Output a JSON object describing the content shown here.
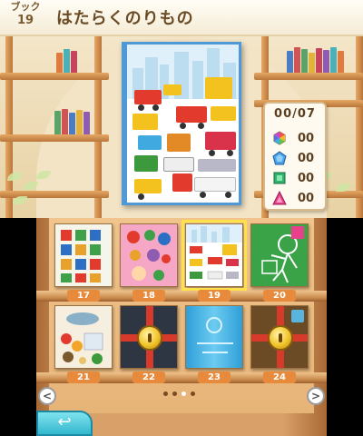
{
  "header": {
    "book_label": "ブック",
    "book_number": "19",
    "title": "はたらくのりもの"
  },
  "stats": {
    "progress": "00/07",
    "rows": [
      {
        "icon": "rainbow-hexagon-icon",
        "value": "00"
      },
      {
        "icon": "blue-pentagon-icon",
        "value": "00"
      },
      {
        "icon": "green-square-icon",
        "value": "00"
      },
      {
        "icon": "pink-triangle-icon",
        "value": "00"
      }
    ]
  },
  "library": {
    "books": [
      {
        "number": "17",
        "locked": false,
        "selected": false,
        "theme": "sports pictograms"
      },
      {
        "number": "18",
        "locked": false,
        "selected": false,
        "theme": "colorful numbers"
      },
      {
        "number": "19",
        "locked": false,
        "selected": true,
        "theme": "working vehicles"
      },
      {
        "number": "20",
        "locked": false,
        "selected": false,
        "theme": "green drawing"
      },
      {
        "number": "21",
        "locked": false,
        "selected": false,
        "theme": "food"
      },
      {
        "number": "22",
        "locked": true,
        "selected": false,
        "theme": "dark cover"
      },
      {
        "number": "23",
        "locked": true,
        "selected": false,
        "theme": "blue cover"
      },
      {
        "number": "24",
        "locked": true,
        "selected": false,
        "theme": "brown cover"
      }
    ],
    "page_dots": 4,
    "current_page": 3
  },
  "nav": {
    "prev_label": "<",
    "next_label": ">",
    "back_label": "↩"
  },
  "colors": {
    "accent_orange": "#e88a3c",
    "selection_yellow": "#ffe24a",
    "back_teal": "#34b7cf"
  }
}
